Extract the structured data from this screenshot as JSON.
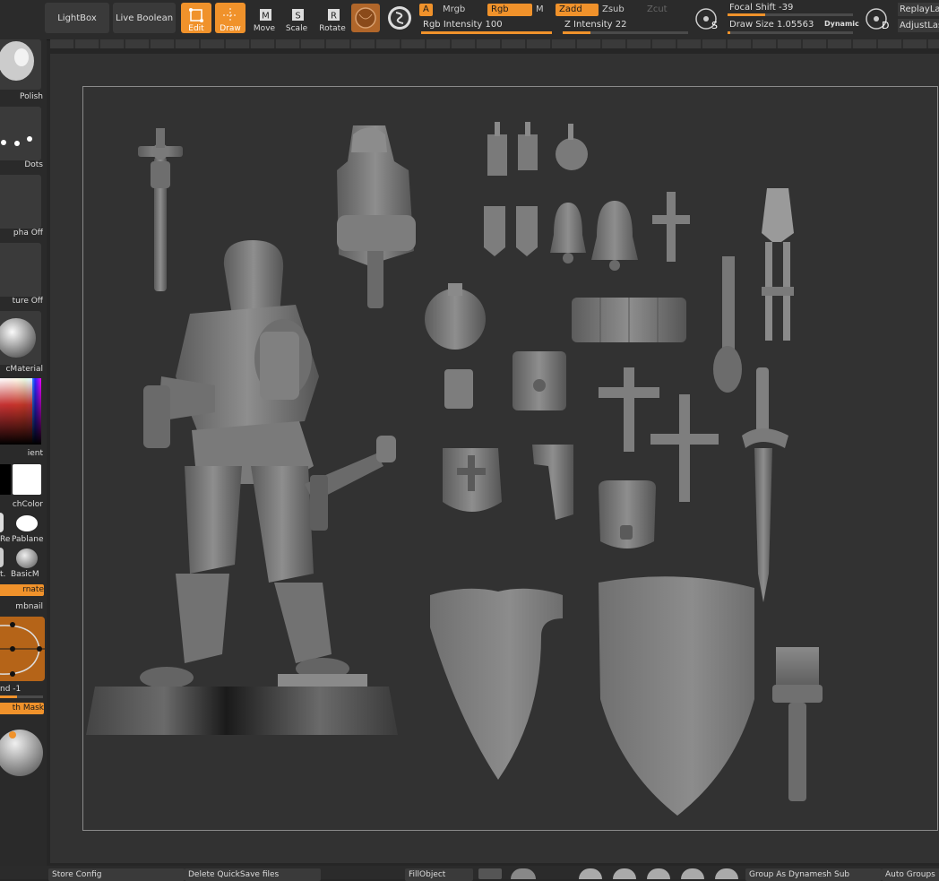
{
  "top_bar": {
    "lightbox_label": "LightBox",
    "live_boolean_label": "Live Boolean",
    "tools": [
      {
        "key": "",
        "label": "Edit",
        "active": true
      },
      {
        "key": "",
        "label": "Draw",
        "active": true
      },
      {
        "key": "M",
        "label": "Move",
        "active": false
      },
      {
        "key": "S",
        "label": "Scale",
        "active": false
      },
      {
        "key": "R",
        "label": "Rotate",
        "active": false
      }
    ],
    "a_label": "A",
    "mrgb_label": "Mrgb",
    "rgb_label": "Rgb",
    "m_label": "M",
    "zadd_label": "Zadd",
    "zsub_label": "Zsub",
    "zcut_label": "Zcut",
    "rgb_intensity": {
      "label": "Rgb Intensity",
      "value": "100",
      "fraction": 1.0
    },
    "z_intensity": {
      "label": "Z Intensity",
      "value": "22",
      "fraction": 0.22
    },
    "focal_shift": {
      "label": "Focal Shift",
      "value": "-39",
      "fraction": 0.3
    },
    "draw_size": {
      "label": "Draw Size",
      "value": "1.05563",
      "fraction": 0.02
    },
    "dynamic_label": "Dynamic",
    "s_key": "S",
    "d_key": "D",
    "replay_label": "ReplayLa",
    "adjust_label": "AdjustLas"
  },
  "left_shelf": {
    "polish_label": "Polish",
    "dots_label": "Dots",
    "alpha_label": "pha Off",
    "texture_label": "ture Off",
    "material_label": "cMaterial",
    "gradient_label": "ient",
    "switch_color_label": "chColor",
    "mat_left_label": "Re",
    "mat_right_label": "Pablane",
    "mat2_left_label": "t.",
    "mat2_right_label": "BasicM",
    "alternate_label": "rnate",
    "thumbnail_label": "mbnail",
    "blend_label": "nd -1",
    "blend_fraction": 0.4,
    "mask_label": "th Mask",
    "colors": {
      "main": "#000000",
      "secondary": "#ffffff"
    }
  },
  "bottom_bar": {
    "store_config": "Store Config",
    "delete_quicksave": "Delete QuickSave files",
    "fill_object": "FillObject",
    "group_dynamesh": "Group As Dynamesh Sub",
    "auto_groups": "Auto Groups"
  },
  "colors": {
    "accent": "#f0922b",
    "panel": "#3a3a3a",
    "canvas": "#323232"
  }
}
